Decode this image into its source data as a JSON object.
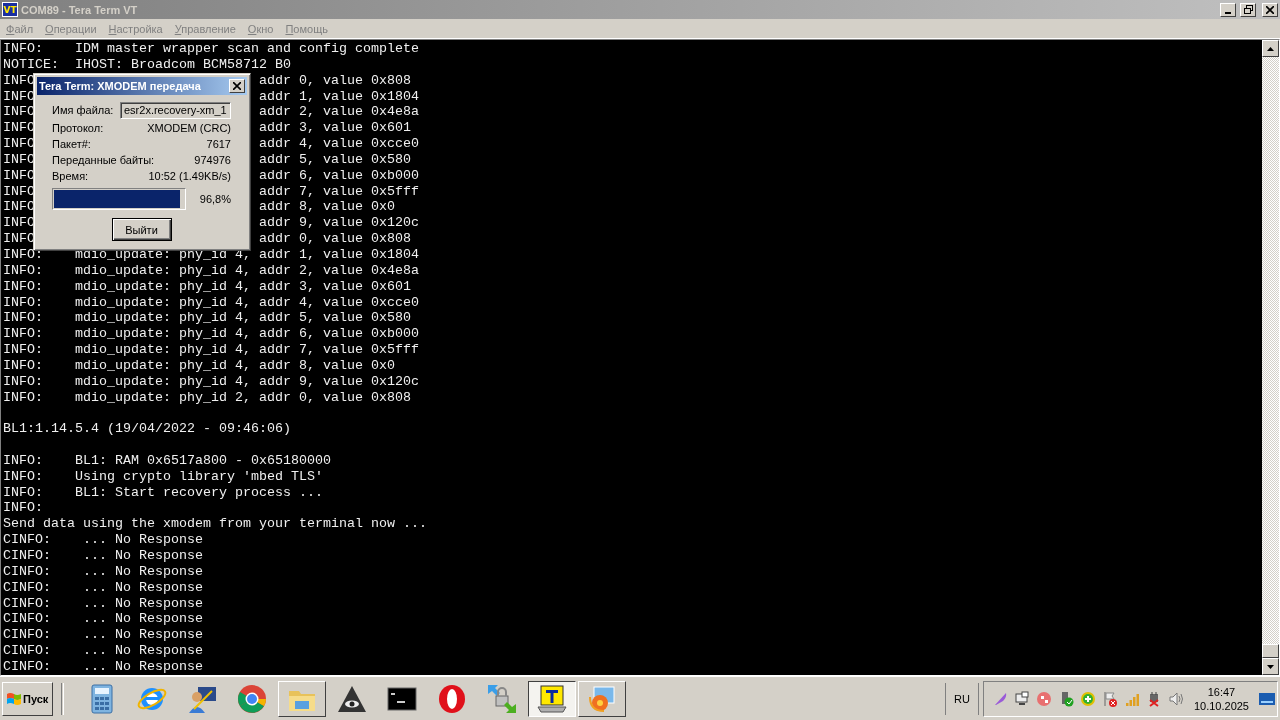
{
  "window": {
    "icon_text": "VT",
    "title": "COM89 - Tera Term VT"
  },
  "menu": [
    {
      "label": "Файл"
    },
    {
      "label": "Операции"
    },
    {
      "label": "Настройка"
    },
    {
      "label": "Управление"
    },
    {
      "label": "Окно"
    },
    {
      "label": "Помощь"
    }
  ],
  "terminal": {
    "lines": [
      {
        "kind": "line",
        "text": "INFO:    IDM master wrapper scan and config complete"
      },
      {
        "kind": "line",
        "text": "NOTICE:  IHOST: Broadcom BCM58712 B0"
      },
      {
        "kind": "split",
        "left": "INFO",
        "right": "addr 0, value 0x808"
      },
      {
        "kind": "split",
        "left": "INFO",
        "right": "addr 1, value 0x1804"
      },
      {
        "kind": "split",
        "left": "INFO",
        "right": "addr 2, value 0x4e8a"
      },
      {
        "kind": "split",
        "left": "INFO",
        "right": "addr 3, value 0x601"
      },
      {
        "kind": "split",
        "left": "INFO",
        "right": "addr 4, value 0xcce0"
      },
      {
        "kind": "split",
        "left": "INFO",
        "right": "addr 5, value 0x580"
      },
      {
        "kind": "split",
        "left": "INFO",
        "right": "addr 6, value 0xb000"
      },
      {
        "kind": "split",
        "left": "INFO",
        "right": "addr 7, value 0x5fff"
      },
      {
        "kind": "split",
        "left": "INFO",
        "right": "addr 8, value 0x0"
      },
      {
        "kind": "split",
        "left": "INFO",
        "right": "addr 9, value 0x120c"
      },
      {
        "kind": "split",
        "left": "INFO",
        "right": "addr 0, value 0x808"
      },
      {
        "kind": "line",
        "text": "INFO:    mdio_update: phy_id 4, addr 1, value 0x1804"
      },
      {
        "kind": "line",
        "text": "INFO:    mdio_update: phy_id 4, addr 2, value 0x4e8a"
      },
      {
        "kind": "line",
        "text": "INFO:    mdio_update: phy_id 4, addr 3, value 0x601"
      },
      {
        "kind": "line",
        "text": "INFO:    mdio_update: phy_id 4, addr 4, value 0xcce0"
      },
      {
        "kind": "line",
        "text": "INFO:    mdio_update: phy_id 4, addr 5, value 0x580"
      },
      {
        "kind": "line",
        "text": "INFO:    mdio_update: phy_id 4, addr 6, value 0xb000"
      },
      {
        "kind": "line",
        "text": "INFO:    mdio_update: phy_id 4, addr 7, value 0x5fff"
      },
      {
        "kind": "line",
        "text": "INFO:    mdio_update: phy_id 4, addr 8, value 0x0"
      },
      {
        "kind": "line",
        "text": "INFO:    mdio_update: phy_id 4, addr 9, value 0x120c"
      },
      {
        "kind": "line",
        "text": "INFO:    mdio_update: phy_id 2, addr 0, value 0x808"
      },
      {
        "kind": "blank"
      },
      {
        "kind": "line",
        "text": "BL1:1.14.5.4 (19/04/2022 - 09:46:06)"
      },
      {
        "kind": "blank"
      },
      {
        "kind": "line",
        "text": "INFO:    BL1: RAM 0x6517a800 - 0x65180000"
      },
      {
        "kind": "line",
        "text": "INFO:    Using crypto library 'mbed TLS'"
      },
      {
        "kind": "line",
        "text": "INFO:    BL1: Start recovery process ..."
      },
      {
        "kind": "line",
        "text": "INFO:"
      },
      {
        "kind": "line",
        "text": "Send data using the xmodem from your terminal now ..."
      },
      {
        "kind": "line",
        "text": "CINFO:    ... No Response"
      },
      {
        "kind": "line",
        "text": "CINFO:    ... No Response"
      },
      {
        "kind": "line",
        "text": "CINFO:    ... No Response"
      },
      {
        "kind": "line",
        "text": "CINFO:    ... No Response"
      },
      {
        "kind": "line",
        "text": "CINFO:    ... No Response"
      },
      {
        "kind": "line",
        "text": "CINFO:    ... No Response"
      },
      {
        "kind": "line",
        "text": "CINFO:    ... No Response"
      },
      {
        "kind": "line",
        "text": "CINFO:    ... No Response"
      },
      {
        "kind": "line",
        "text": "CINFO:    ... No Response"
      }
    ]
  },
  "dialog": {
    "title": "Tera Term: XMODEM передача",
    "fields": [
      {
        "kind": "input",
        "label": "Имя файла:",
        "value": "esr2x.recovery-xm_1"
      },
      {
        "kind": "text",
        "label": "Протокол:",
        "value": "XMODEM (CRC)"
      },
      {
        "kind": "text",
        "label": "Пакет#:",
        "value": "7617"
      },
      {
        "kind": "text",
        "label": "Переданные байты:",
        "value": "974976"
      },
      {
        "kind": "text",
        "label": "Время:",
        "value": "10:52 (1.49KB/s)"
      }
    ],
    "progress": {
      "level": 0.968,
      "reading": "96,8%"
    },
    "button": "Выйти"
  },
  "taskbar": {
    "start": "Пуск",
    "items": [
      {
        "open": false,
        "selected": false
      },
      {
        "open": false,
        "selected": false
      },
      {
        "open": false,
        "selected": false
      },
      {
        "open": false,
        "selected": false
      },
      {
        "open": true,
        "selected": false
      },
      {
        "open": false,
        "selected": false
      },
      {
        "open": false,
        "selected": false
      },
      {
        "open": false,
        "selected": false
      },
      {
        "open": false,
        "selected": false
      },
      {
        "open": true,
        "selected": true
      },
      {
        "open": true,
        "selected": false
      }
    ],
    "language": "RU",
    "time": "16:47",
    "date": "10.10.2025"
  }
}
